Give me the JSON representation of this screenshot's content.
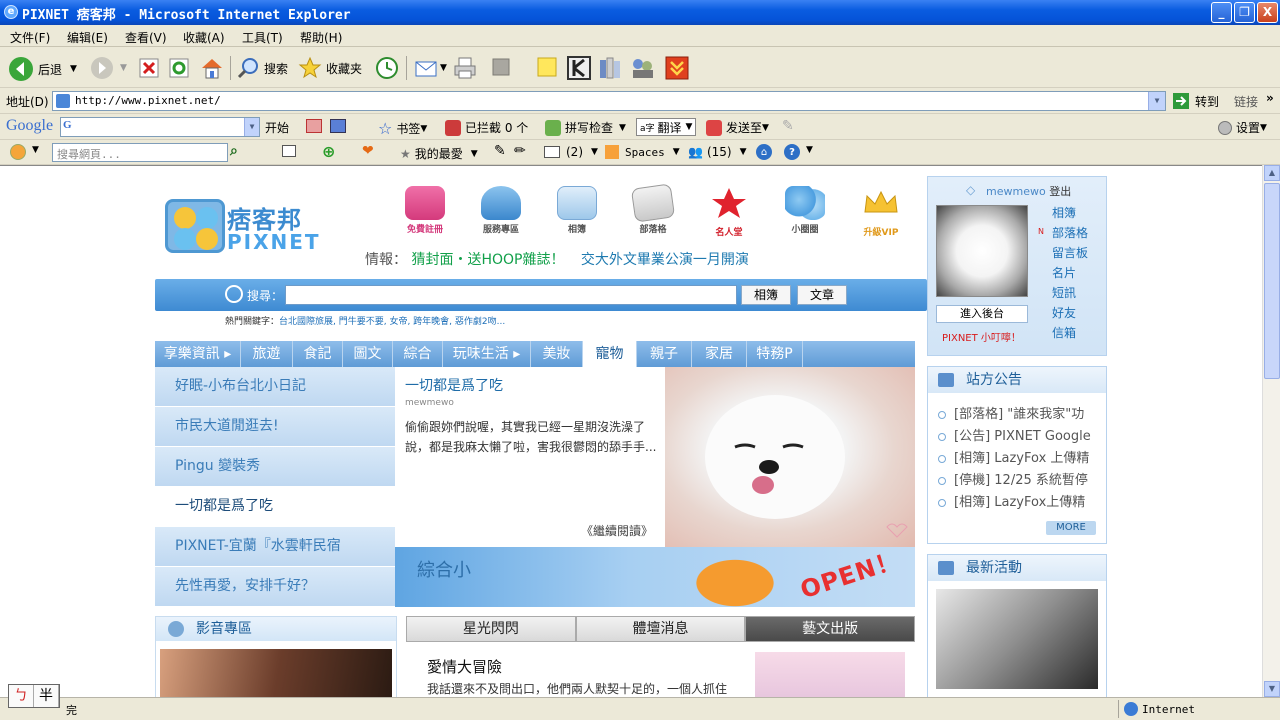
{
  "window": {
    "title": "PIXNET 痞客邦 - Microsoft Internet Explorer",
    "min": "_",
    "max": "❐",
    "close": "X"
  },
  "menu": [
    "文件(F)",
    "编辑(E)",
    "查看(V)",
    "收藏(A)",
    "工具(T)",
    "帮助(H)"
  ],
  "toolbar": {
    "back": "后退",
    "search": "搜索",
    "favorites": "收藏夹"
  },
  "address": {
    "label": "地址(D)",
    "url": "http://www.pixnet.net/",
    "go": "转到",
    "links": "链接"
  },
  "google_bar": {
    "brand": "Google",
    "start": "开始",
    "bookmark": "书签",
    "blocked": "已拦截 0 个",
    "spellcheck": "拼写检查",
    "translate": "翻译",
    "sendto": "发送至",
    "settings": "设置"
  },
  "live_bar": {
    "search_placeholder": "搜尋網頁...",
    "favorites": "我的最愛",
    "mail_count": "(2)",
    "spaces": "Spaces",
    "messenger_count": "(15)"
  },
  "page": {
    "logo_cn": "痞客邦",
    "logo_en": "PIXNET",
    "nav_icons": [
      "免費註冊",
      "服務專區",
      "相簿",
      "部落格",
      "名人堂",
      "小圈圈",
      "升級VIP"
    ],
    "news_label": "情報：",
    "news1": "猜封面・送HOOP雜誌！",
    "news2": "交大外文畢業公演一月開演",
    "search_label": "搜尋：",
    "btn_album": "相簿",
    "btn_article": "文章",
    "hot_label": "熱門關鍵字：",
    "hot_values": "台北國際旅展, 門牛要不要, 女帝, 跨年晚會, 惡作劇2吻...",
    "categories": [
      "享樂資訊 ▸",
      "旅遊",
      "食記",
      "圖文",
      "綜合",
      "玩味生活 ▸",
      "美妝",
      "寵物",
      "親子",
      "家居",
      "特務P"
    ],
    "left_list": [
      "好眠-小布台北小日記",
      "市民大道閒逛去!",
      "Pingu 變裝秀",
      "一切都是爲了吃",
      "PIXNET-宜蘭『水雲軒民宿",
      "先性再愛，安排千好？"
    ],
    "feature": {
      "title": "一切都是爲了吃",
      "author": "mewmewo",
      "desc": "偷偷跟妳們說喔，其實我已經一星期沒洗澡了說，都是我麻太懶了啦，害我很鬱悶的舔手手...",
      "more": "《繼續閱讀》"
    },
    "banner": {
      "title": "綜合小",
      "open": "OPEN！"
    },
    "media": {
      "title": "影音專區"
    },
    "tabs": [
      "星光閃閃",
      "體壇消息",
      "藝文出版"
    ],
    "article": {
      "title": "愛情大冒險",
      "desc": "我話還來不及問出口，他們兩人默契十足的，一個人抓住"
    },
    "member": {
      "username": "mewmewo",
      "logout": "登出",
      "links": [
        "相簿",
        "部落格",
        "留言板",
        "名片",
        "短訊",
        "好友",
        "信箱"
      ],
      "new_mark": "N",
      "backend": "進入後台",
      "notice": "PIXNET 小叮嚀！"
    },
    "announce": {
      "title": "站方公告",
      "items": [
        "[部落格] \"誰來我家\"功",
        "[公告] PIXNET Google",
        "[相簿] LazyFox 上傳精",
        "[停機] 12/25 系統暫停",
        "[相簿] LazyFox上傳精"
      ],
      "more": "MORE"
    },
    "activity": {
      "title": "最新活動"
    }
  },
  "status": {
    "zone": "Internet",
    "text": "完"
  },
  "ime": [
    "ㄅ",
    "半"
  ]
}
